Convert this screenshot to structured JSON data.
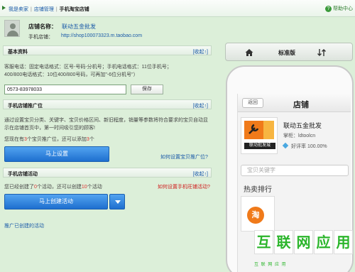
{
  "breadcrumb": {
    "items": [
      "我是卖家",
      "店铺管理"
    ],
    "current": "手机淘宝店铺"
  },
  "help": {
    "label": "帮助中心"
  },
  "shop": {
    "name_label": "店铺名称：",
    "name": "联动五金批发",
    "url_label": "手机店铺：",
    "url": "http://shop100073323.m.taobao.com"
  },
  "basic": {
    "title": "基本资料",
    "toggle": "[收起↑]",
    "hint_line1": "客服电话：固定电话格式：区号-号码-分机号；手机电话格式：11位手机号；",
    "hint_line2": "400/800电话格式：10位400/800号码，可再加\"-6位分机号\"）",
    "phone_value": "0573-83978033",
    "save_label": "保存"
  },
  "promo": {
    "title": "手机店铺推广位",
    "toggle": "[收起↑]",
    "desc_line1": "通过设置宝贝分类、关键字、宝贝价格区间、新旧程度，销量等参数将符合要求的宝贝自动显",
    "desc_line2": "示在店铺首页中，第一时间吸引您的顾客!",
    "count_prefix": "您现在有",
    "count_value": "3",
    "count_mid": "个宝贝推广位，还可以添加",
    "count_remaining": "3",
    "count_suffix": "个",
    "set_button": "马上设置",
    "how_link": "如何设置宝贝推广位?"
  },
  "activity": {
    "title": "手机店铺活动",
    "toggle": "[收起↑]",
    "created_prefix": "您已经创建了",
    "created_count": "0",
    "created_mid": "个活动，还可以创建",
    "created_remaining": "10",
    "created_suffix": "个活动",
    "how_link": "如何设置手机旺铺活动?",
    "create_button": "马上创建活动",
    "created_link": "推广已创建的活动"
  },
  "preview": {
    "mode_label": "标准版",
    "back_label": "返回",
    "title": "店铺",
    "shop_name": "联动五金批发",
    "owner": "掌柜：ldtoolcn",
    "rating": "好评率 100.00%",
    "logo_text": "联动批发城",
    "search_placeholder": "宝贝关键字",
    "hot_title": "热卖排行",
    "taobao_char": "淘"
  },
  "watermark": {
    "chars": [
      "互",
      "联",
      "网",
      "应",
      "用"
    ],
    "sub": "互 联 网 应 用"
  }
}
